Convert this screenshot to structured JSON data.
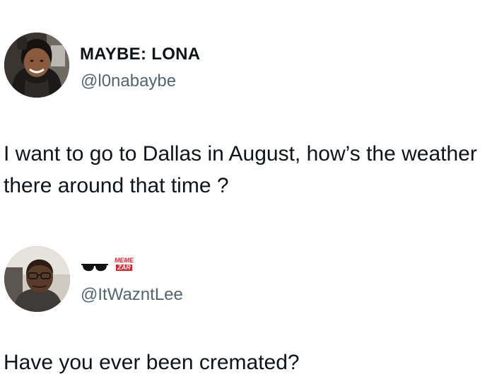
{
  "post_1": {
    "display_name": "MAYBE: LONA",
    "handle": "@l0nabaybe",
    "text": "I want to go to Dallas in August, how’s the weather there around that time ?",
    "avatar_icon": "profile-photo-woman"
  },
  "post_2": {
    "name_emoji": "sunglasses-emoji",
    "badge_line_1": "MEME",
    "badge_line_2": "ZAR",
    "handle": "@ItWazntLee",
    "text": "Have you ever been cremated?",
    "avatar_icon": "profile-photo-man"
  },
  "colors": {
    "text": "#0f1419",
    "handle": "#536471",
    "background": "#ffffff",
    "badge_red": "#e0242b"
  }
}
